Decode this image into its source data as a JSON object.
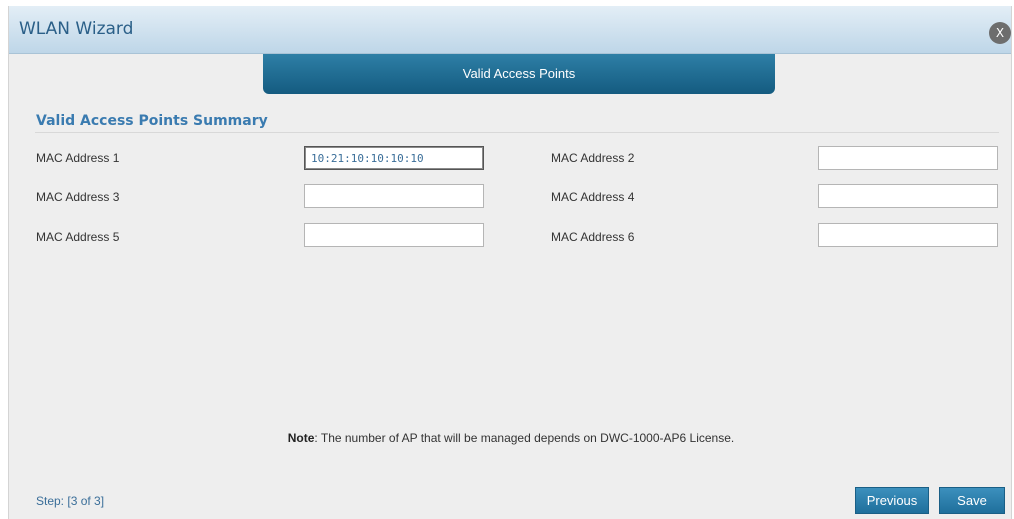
{
  "dialog": {
    "title": "WLAN Wizard",
    "close_label": "X"
  },
  "tab": {
    "label": "Valid Access Points"
  },
  "section": {
    "title": "Valid Access Points Summary"
  },
  "fields": [
    {
      "label": "MAC Address 1",
      "value": "10:21:10:10:10:10"
    },
    {
      "label": "MAC Address 2",
      "value": ""
    },
    {
      "label": "MAC Address 3",
      "value": ""
    },
    {
      "label": "MAC Address 4",
      "value": ""
    },
    {
      "label": "MAC Address 5",
      "value": ""
    },
    {
      "label": "MAC Address 6",
      "value": ""
    }
  ],
  "note": {
    "prefix": "Note",
    "text": ": The number of AP that will be managed depends on DWC-1000-AP6 License."
  },
  "footer": {
    "step": "Step: [3 of 3]",
    "previous_label": "Previous",
    "save_label": "Save"
  },
  "colors": {
    "accent": "#1f6f9c",
    "title_text": "#2a5f88",
    "section_text": "#3a7bb0"
  },
  "icons": {
    "close": "close-icon"
  }
}
